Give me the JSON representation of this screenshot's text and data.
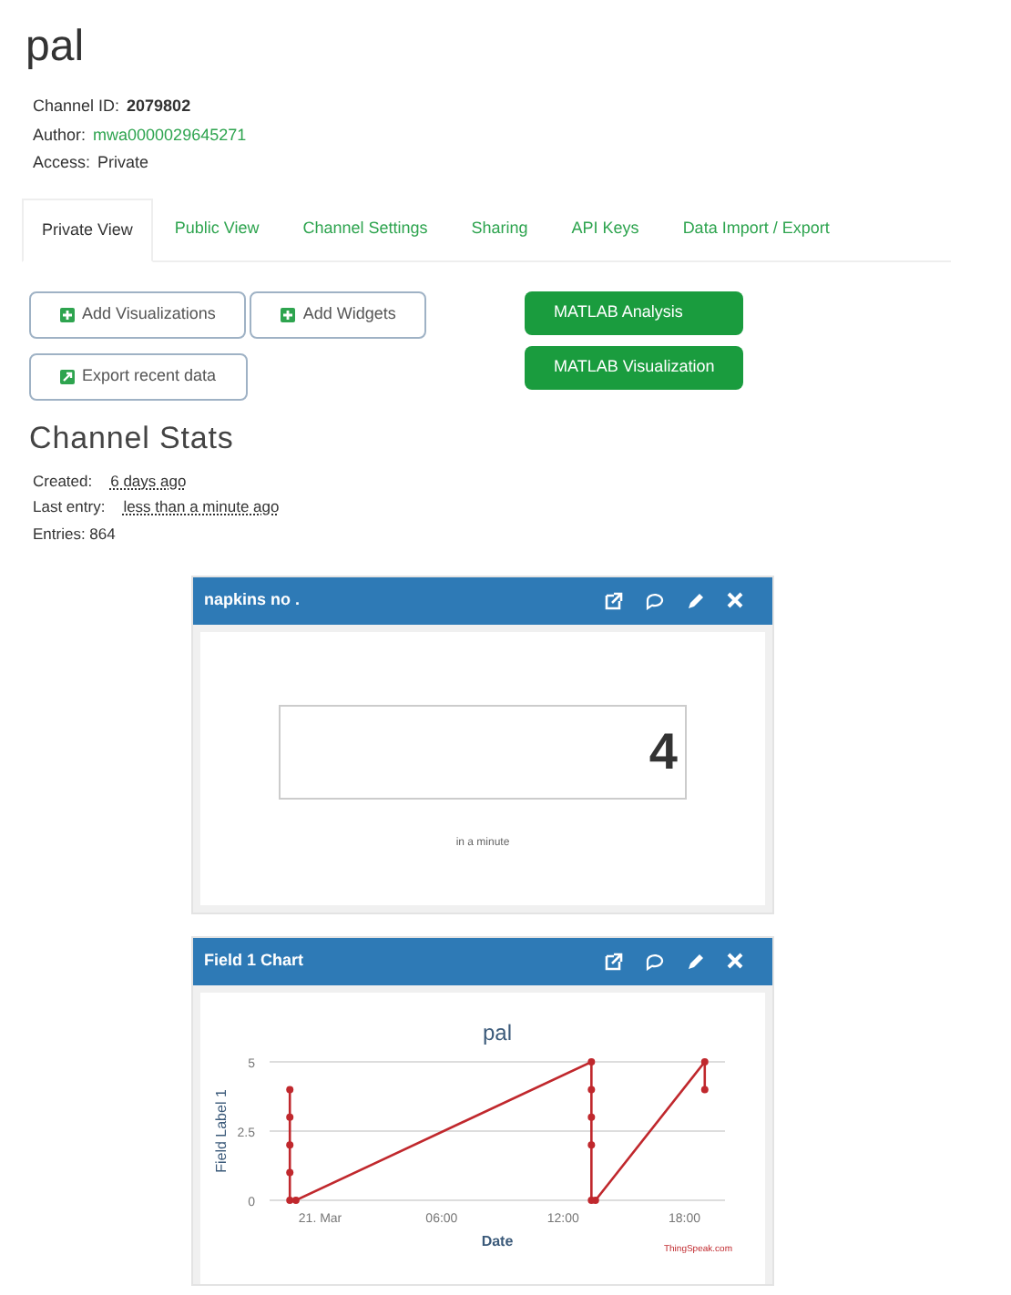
{
  "channel": {
    "name": "pal",
    "info": [
      {
        "label": "Channel ID:",
        "value": "2079802",
        "kind": "bold"
      },
      {
        "label": "Author:",
        "value": "mwa0000029645271",
        "kind": "link"
      },
      {
        "label": "Access:",
        "value": "Private",
        "kind": "plain"
      }
    ]
  },
  "tabs": [
    {
      "label": "Private View",
      "selected": true
    },
    {
      "label": "Public View",
      "selected": false
    },
    {
      "label": "Channel Settings",
      "selected": false
    },
    {
      "label": "Sharing",
      "selected": false
    },
    {
      "label": "API Keys",
      "selected": false
    },
    {
      "label": "Data Import / Export",
      "selected": false
    }
  ],
  "buttons": [
    {
      "label": "Add Visualizations",
      "kind": "plus"
    },
    {
      "label": "Add Widgets",
      "kind": "plus"
    },
    {
      "label": "Export recent data",
      "kind": "export"
    }
  ],
  "matlab_buttons": [
    "MATLAB Analysis",
    "MATLAB Visualization"
  ],
  "stats": {
    "title": "Channel Stats",
    "rows": [
      {
        "label": "Created:",
        "value": "6 days ago"
      },
      {
        "label": "Last entry:",
        "value": "less than a minute ago"
      },
      {
        "label": "Entries: 864"
      }
    ]
  },
  "widgets": [
    {
      "title": "napkins no .",
      "kind": "numeric",
      "value": "4",
      "caption": "in a minute"
    },
    {
      "title": "Field 1 Chart",
      "kind": "chart",
      "credit": "ThingSpeak.com",
      "chart_data": {
        "type": "line",
        "title": "pal",
        "xlabel": "Date",
        "ylabel": "Field Label 1",
        "x": [
          -1.5,
          -1.5,
          -1.5,
          -1.5,
          -1.5,
          -1.2,
          13.4,
          13.4,
          13.4,
          13.4,
          13.4,
          13.6,
          19,
          19
        ],
        "series": [
          {
            "color": "#c0282d",
            "marker": "circle",
            "values": [
              4,
              3,
              2,
              1,
              0,
              0,
              5,
              4,
              3,
              2,
              0,
              0,
              5,
              4
            ]
          }
        ],
        "xlim": [
          -2.5,
          20
        ],
        "ylim": [
          0,
          5
        ],
        "xticks": [
          {
            "value": 0,
            "label": "21. Mar"
          },
          {
            "value": 6,
            "label": "06:00"
          },
          {
            "value": 12,
            "label": "12:00"
          },
          {
            "value": 18,
            "label": "18:00"
          }
        ],
        "yticks": [
          0,
          2.5,
          5
        ]
      }
    }
  ]
}
